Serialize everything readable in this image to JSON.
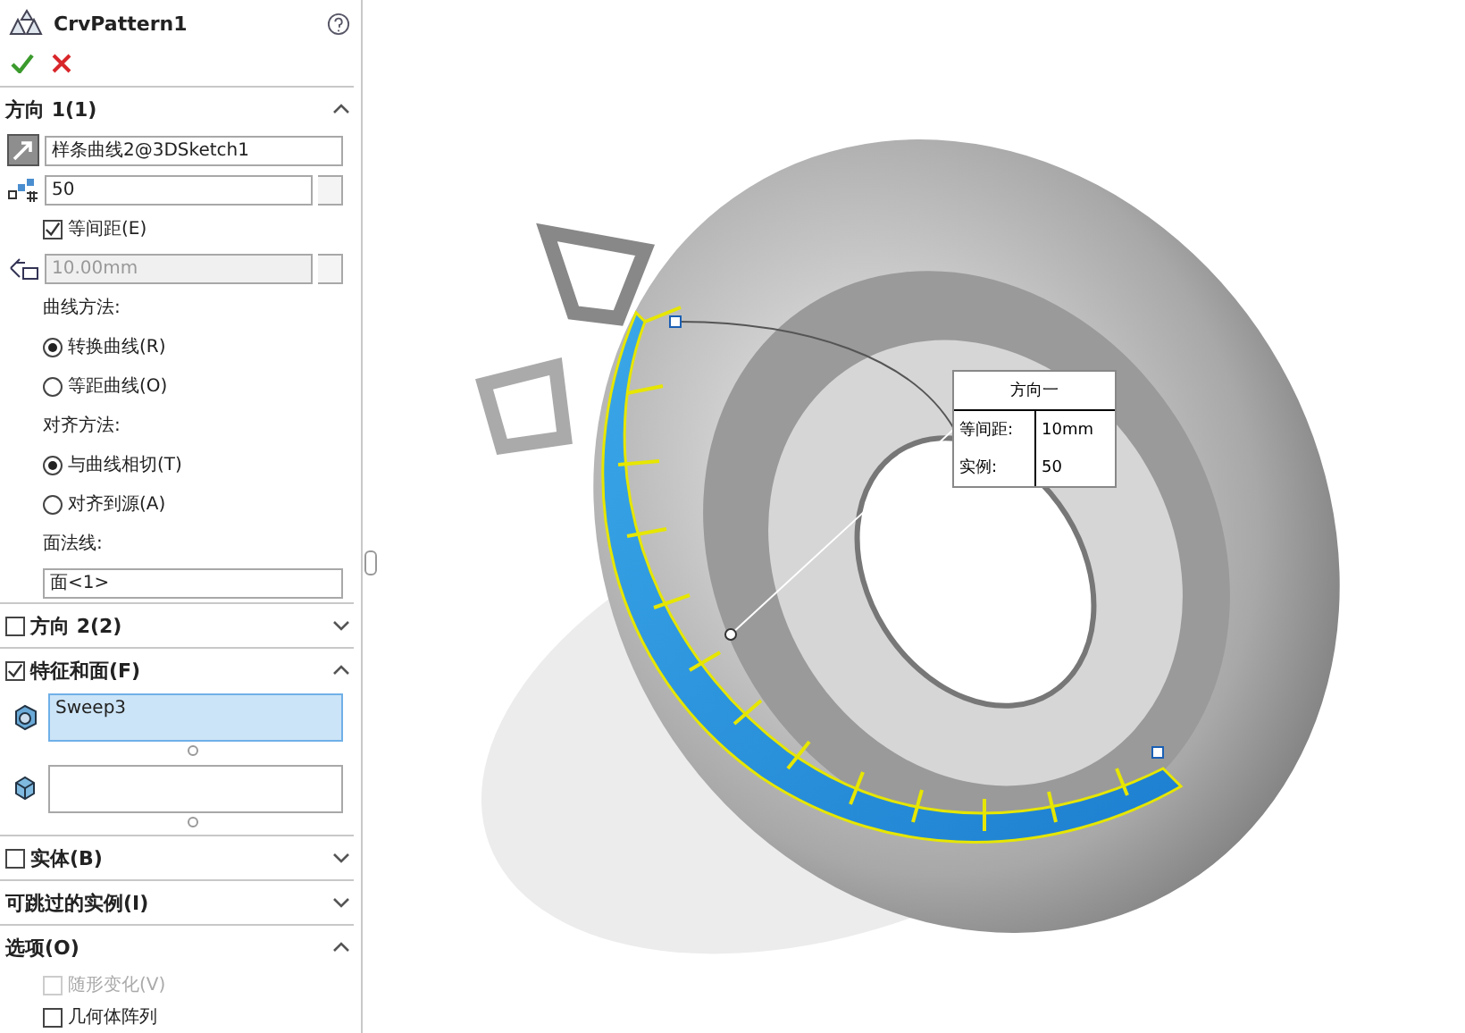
{
  "feature": {
    "title": "CrvPattern1"
  },
  "direction1": {
    "title": "方向 1(1)",
    "expanded": true,
    "curve_value": "样条曲线2@3DSketch1",
    "count_value": "50",
    "equal_spacing": {
      "label": "等间距(E)",
      "checked": true
    },
    "spacing": {
      "value": "10.00mm",
      "disabled": true
    },
    "curve_method": {
      "label": "曲线方法:",
      "options": [
        {
          "label": "转换曲线(R)",
          "selected": true
        },
        {
          "label": "等距曲线(O)",
          "selected": false
        }
      ]
    },
    "align_method": {
      "label": "对齐方法:",
      "options": [
        {
          "label": "与曲线相切(T)",
          "selected": true
        },
        {
          "label": "对齐到源(A)",
          "selected": false
        }
      ]
    },
    "face_normal": {
      "label": "面法线:",
      "value": "面<1>"
    }
  },
  "direction2": {
    "title": "方向 2(2)",
    "checked": false,
    "expanded": false
  },
  "features_faces": {
    "title": "特征和面(F)",
    "checked": true,
    "expanded": true,
    "features_value": "Sweep3"
  },
  "bodies": {
    "title": "实体(B)",
    "checked": false,
    "expanded": false
  },
  "skip_instances": {
    "title": "可跳过的实例(I)",
    "expanded": false
  },
  "options": {
    "title": "选项(O)",
    "expanded": true,
    "items": [
      {
        "label": "随形变化(V)",
        "checked": false,
        "disabled": true
      },
      {
        "label": "几何体阵列",
        "checked": false,
        "disabled": false
      }
    ]
  },
  "callout": {
    "title": "方向一",
    "rows": [
      {
        "label": "等间距:",
        "value": "10mm"
      },
      {
        "label": "实例:",
        "value": "50"
      }
    ]
  }
}
